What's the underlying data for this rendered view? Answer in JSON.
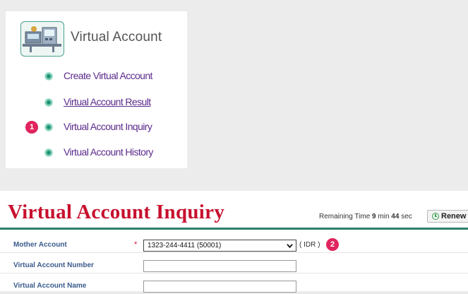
{
  "menu": {
    "title": "Virtual Account",
    "icon": "virtual-account-illustration",
    "items": [
      {
        "label": "Create Virtual Account"
      },
      {
        "label": "Virtual Account Result"
      },
      {
        "label": "Virtual Account Inquiry",
        "badge": "1"
      },
      {
        "label": "Virtual Account History"
      }
    ]
  },
  "panel": {
    "title": "Virtual Account Inquiry",
    "timer": {
      "prefix": "Remaining Time",
      "minutes": "9",
      "min_label": "min",
      "seconds": "44",
      "sec_label": "sec"
    },
    "renew_label": "Renew",
    "fields": {
      "mother_account": {
        "label": "Mother Account",
        "required_mark": "*",
        "value": "1323-244-4411 (50001)",
        "currency": "( IDR )",
        "badge": "2"
      },
      "va_number": {
        "label": "Virtual Account Number",
        "value": ""
      },
      "va_name": {
        "label": "Virtual Account Name",
        "value": ""
      }
    }
  },
  "colors": {
    "title_red": "#c8102e",
    "menu_purple": "#5b2b8c",
    "accent_teal": "#2c7e6c",
    "badge_pink": "#e0245e",
    "label_blue": "#3a5b8c"
  }
}
